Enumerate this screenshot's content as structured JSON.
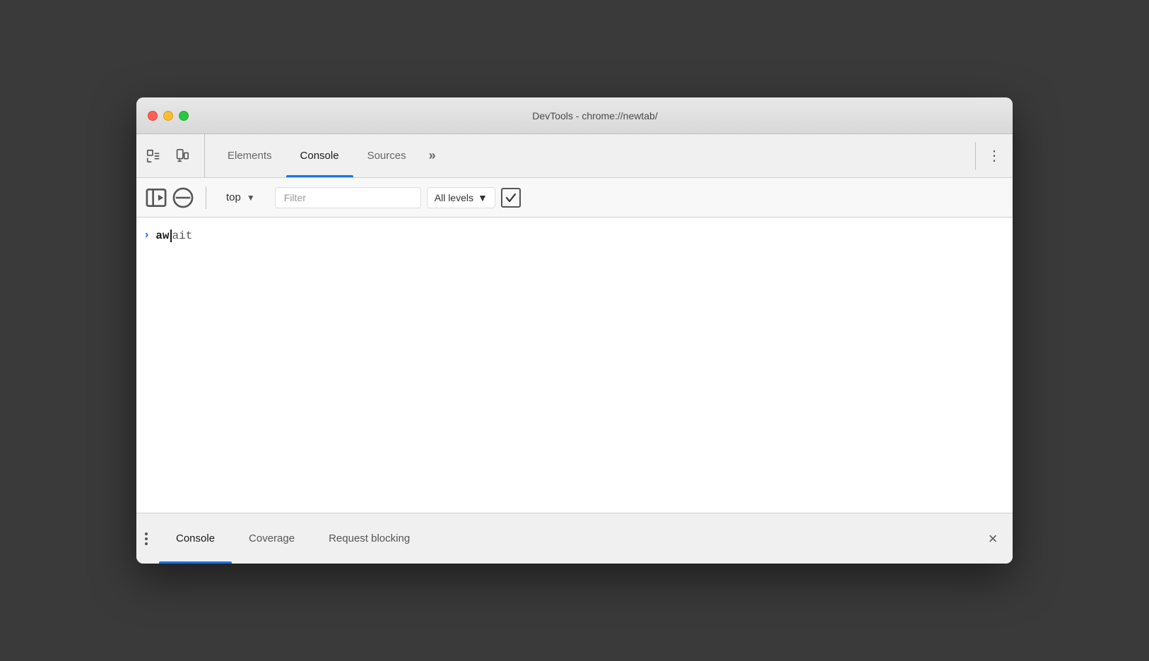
{
  "window": {
    "title": "DevTools - chrome://newtab/"
  },
  "traffic_lights": {
    "close_label": "close",
    "minimize_label": "minimize",
    "maximize_label": "maximize"
  },
  "tabs": [
    {
      "id": "elements",
      "label": "Elements",
      "active": false
    },
    {
      "id": "console",
      "label": "Console",
      "active": true
    },
    {
      "id": "sources",
      "label": "Sources",
      "active": false
    }
  ],
  "tab_more_label": "»",
  "tab_menu_label": "⋮",
  "console_toolbar": {
    "context": {
      "value": "top",
      "dropdown_arrow": "▼"
    },
    "filter": {
      "placeholder": "Filter",
      "value": ""
    },
    "levels": {
      "label": "All levels",
      "dropdown_arrow": "▼"
    }
  },
  "console_output": {
    "entries": [
      {
        "id": "entry-1",
        "chevron": ">",
        "bold_text": "aw",
        "cursor": true,
        "light_text": "ait"
      }
    ]
  },
  "bottom_drawer": {
    "tabs": [
      {
        "id": "console",
        "label": "Console",
        "active": true
      },
      {
        "id": "coverage",
        "label": "Coverage",
        "active": false
      },
      {
        "id": "request-blocking",
        "label": "Request blocking",
        "active": false
      }
    ],
    "close_label": "×"
  },
  "icons": {
    "inspect_element": "inspect-element-icon",
    "device_toolbar": "device-toolbar-icon",
    "no_entry": "no-entry-icon",
    "sidebar_show": "sidebar-show-icon"
  }
}
